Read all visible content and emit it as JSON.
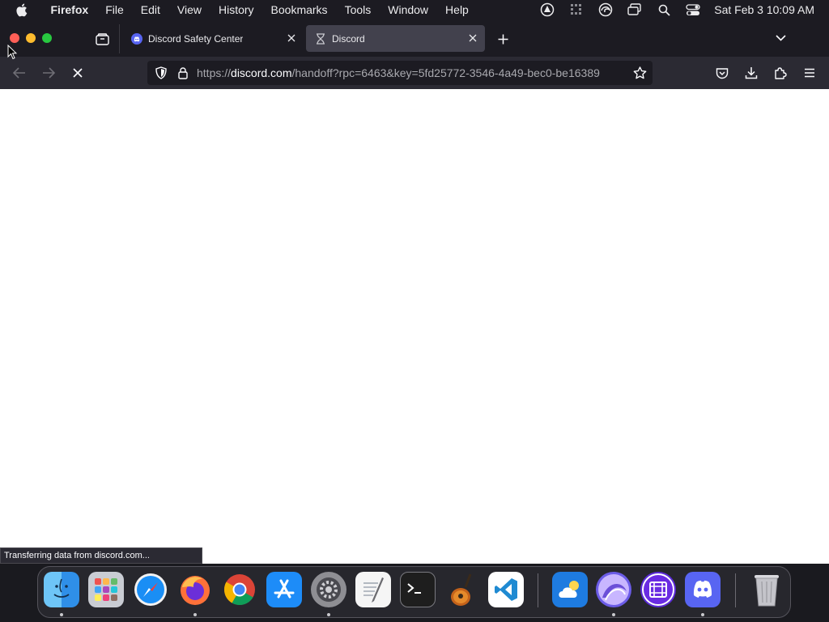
{
  "menubar": {
    "apple_icon": "apple-icon",
    "app_name": "Firefox",
    "menus": [
      "File",
      "Edit",
      "View",
      "History",
      "Bookmarks",
      "Tools",
      "Window",
      "Help"
    ],
    "status_icons": [
      "vpn-icon",
      "grid-icon",
      "edge-icon",
      "screens-icon",
      "spotlight-search-icon",
      "control-center-icon"
    ],
    "clock": "Sat Feb 3  10:09 AM"
  },
  "tabs": [
    {
      "label": "Discord Safety Center",
      "favicon": "discord-icon",
      "active": false
    },
    {
      "label": "Discord",
      "favicon": "hourglass-icon",
      "active": true
    }
  ],
  "toolbar": {
    "url_prefix": "https://",
    "url_host": "discord.com",
    "url_path": "/handoff?rpc=6463&key=5fd25772-3546-4a49-bec0-be16389"
  },
  "status_text": "Transferring data from discord.com...",
  "dock": [
    {
      "name": "Finder",
      "icon": "finder-icon",
      "running": true
    },
    {
      "name": "Launchpad",
      "icon": "launchpad-icon",
      "running": false
    },
    {
      "name": "Safari",
      "icon": "safari-icon",
      "running": false
    },
    {
      "name": "Firefox",
      "icon": "firefox-icon",
      "running": true
    },
    {
      "name": "Google Chrome",
      "icon": "chrome-icon",
      "running": false
    },
    {
      "name": "App Store",
      "icon": "app-store-icon",
      "running": false
    },
    {
      "name": "System Settings",
      "icon": "system-settings-icon",
      "running": true
    },
    {
      "name": "TextEdit",
      "icon": "textedit-icon",
      "running": false
    },
    {
      "name": "Terminal",
      "icon": "terminal-icon",
      "running": false
    },
    {
      "name": "GarageBand",
      "icon": "garageband-icon",
      "running": false
    },
    {
      "name": "Visual Studio Code",
      "icon": "vscode-icon",
      "running": false
    },
    {
      "name": "Weather",
      "icon": "weather-icon",
      "running": false
    },
    {
      "name": "Loader",
      "icon": "loader-app-icon",
      "running": true
    },
    {
      "name": "Film",
      "icon": "film-app-icon",
      "running": false
    },
    {
      "name": "Discord",
      "icon": "discord-dock-icon",
      "running": true
    },
    {
      "name": "Trash",
      "icon": "trash-icon",
      "running": false
    }
  ],
  "colors": {
    "chrome_dark": "#1c1b22",
    "toolbar": "#2b2a33",
    "active_tab": "#42414d",
    "discord_blurple": "#5865f2"
  }
}
